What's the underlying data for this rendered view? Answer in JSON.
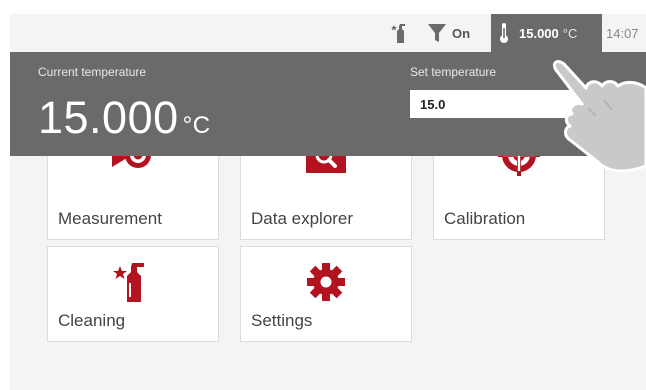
{
  "status_bar": {
    "cleaning_icon": "cleaning-spray-icon",
    "filter_icon": "filter-icon",
    "filter_label": "On",
    "temperature_icon": "thermometer-icon",
    "temperature_value": "15.000",
    "temperature_unit": "°C",
    "time": "14:07"
  },
  "temperature_panel": {
    "current_label": "Current temperature",
    "current_value": "15.000",
    "current_unit": "°C",
    "set_label": "Set temperature",
    "set_value": "15.0"
  },
  "tiles": [
    {
      "label": "Measurement",
      "icon": "measurement-icon"
    },
    {
      "label": "Data explorer",
      "icon": "data-explorer-icon"
    },
    {
      "label": "Calibration",
      "icon": "calibration-target-icon"
    },
    {
      "label": "Cleaning",
      "icon": "cleaning-spray-icon"
    },
    {
      "label": "Settings",
      "icon": "settings-gear-icon"
    }
  ],
  "colors": {
    "accent": "#b3121f",
    "panel": "#6a6b68",
    "background": "#f4f4f4"
  }
}
